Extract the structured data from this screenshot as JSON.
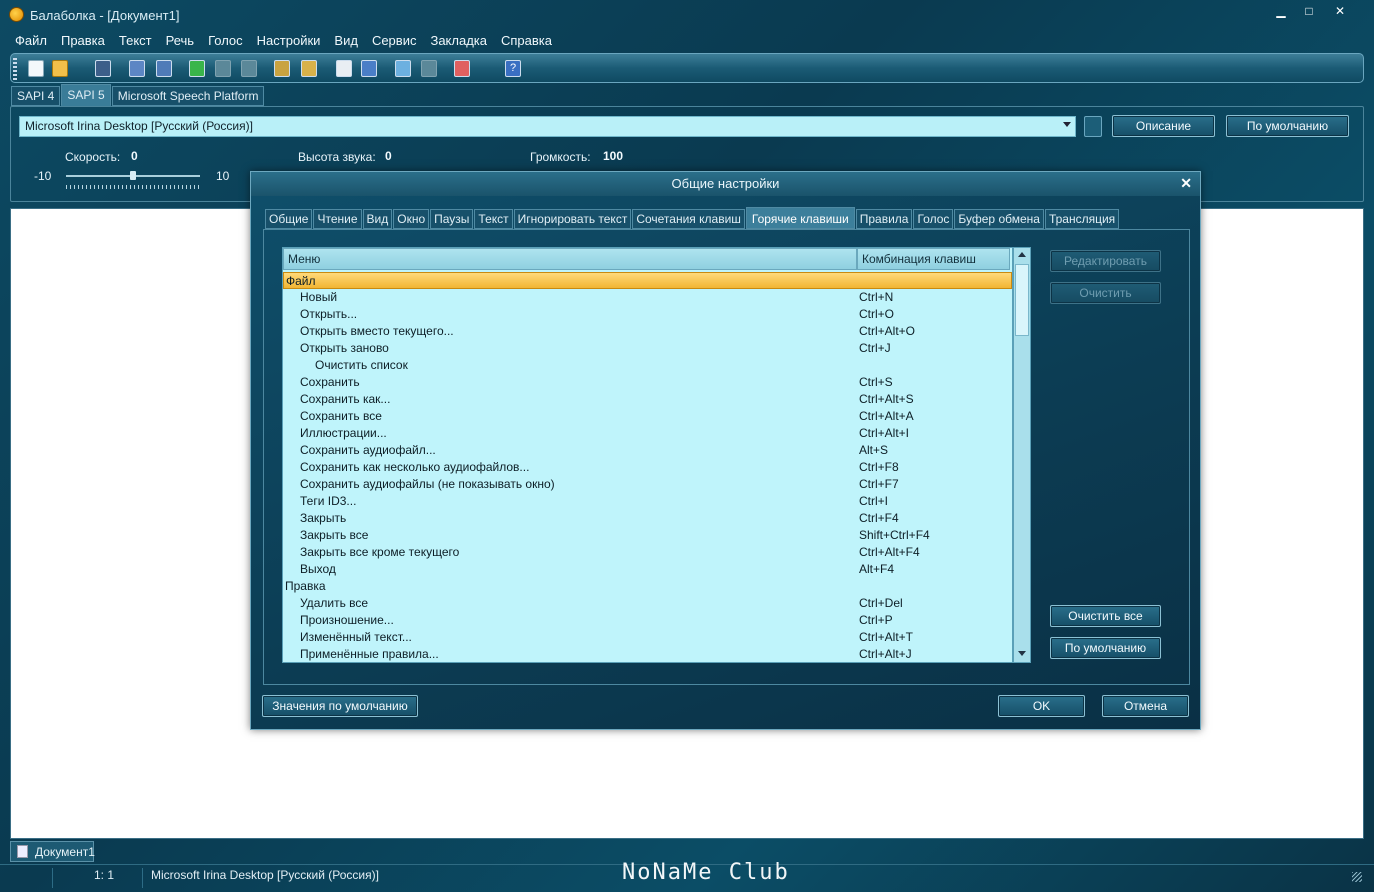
{
  "window": {
    "title": "Балаболка - [Документ1]",
    "controls": {
      "minimize": "▁",
      "maximize": "□",
      "close": "✕"
    }
  },
  "menu": [
    "Файл",
    "Правка",
    "Текст",
    "Речь",
    "Голос",
    "Настройки",
    "Вид",
    "Сервис",
    "Закладка",
    "Справка"
  ],
  "engine_tabs": [
    "SAPI 4",
    "SAPI 5",
    "Microsoft Speech Platform"
  ],
  "engine_tab_active": "SAPI 5",
  "voice": {
    "selected": "Microsoft Irina Desktop [Русский (Россия)]",
    "description_button": "Описание",
    "default_button": "По умолчанию"
  },
  "params": {
    "speed_label": "Скорость:",
    "speed_value": "0",
    "pitch_label": "Высота звука:",
    "pitch_value": "0",
    "volume_label": "Громкость:",
    "volume_value": "100",
    "slider_min": "-10",
    "slider_max": "10"
  },
  "dialog": {
    "title": "Общие настройки",
    "close": "✕",
    "tabs": [
      "Общие",
      "Чтение",
      "Вид",
      "Окно",
      "Паузы",
      "Текст",
      "Игнорировать текст",
      "Сочетания клавиш",
      "Горячие клавиши",
      "Правила",
      "Голос",
      "Буфер обмена",
      "Трансляция"
    ],
    "active_tab": "Горячие клавиши",
    "grid": {
      "columns": [
        "Меню",
        "Комбинация клавиш"
      ],
      "rows": [
        {
          "menu": "Файл",
          "keys": "",
          "level": 0,
          "selected": true
        },
        {
          "menu": "Новый",
          "keys": "Ctrl+N",
          "level": 1
        },
        {
          "menu": "Открыть...",
          "keys": "Ctrl+O",
          "level": 1
        },
        {
          "menu": "Открыть вместо текущего...",
          "keys": "Ctrl+Alt+O",
          "level": 1
        },
        {
          "menu": "Открыть заново",
          "keys": "Ctrl+J",
          "level": 1
        },
        {
          "menu": "Очистить список",
          "keys": "",
          "level": 2
        },
        {
          "menu": "Сохранить",
          "keys": "Ctrl+S",
          "level": 1
        },
        {
          "menu": "Сохранить как...",
          "keys": "Ctrl+Alt+S",
          "level": 1
        },
        {
          "menu": "Сохранить все",
          "keys": "Ctrl+Alt+A",
          "level": 1
        },
        {
          "menu": "Иллюстрации...",
          "keys": "Ctrl+Alt+I",
          "level": 1
        },
        {
          "menu": "Сохранить аудиофайл...",
          "keys": "Alt+S",
          "level": 1
        },
        {
          "menu": "Сохранить как несколько аудиофайлов...",
          "keys": "Ctrl+F8",
          "level": 1
        },
        {
          "menu": "Сохранить аудиофайлы (не показывать окно)",
          "keys": "Ctrl+F7",
          "level": 1
        },
        {
          "menu": "Теги ID3...",
          "keys": "Ctrl+I",
          "level": 1
        },
        {
          "menu": "Закрыть",
          "keys": "Ctrl+F4",
          "level": 1
        },
        {
          "menu": "Закрыть все",
          "keys": "Shift+Ctrl+F4",
          "level": 1
        },
        {
          "menu": "Закрыть все кроме текущего",
          "keys": "Ctrl+Alt+F4",
          "level": 1
        },
        {
          "menu": "Выход",
          "keys": "Alt+F4",
          "level": 1
        },
        {
          "menu": "Правка",
          "keys": "",
          "level": 0
        },
        {
          "menu": "Удалить все",
          "keys": "Ctrl+Del",
          "level": 1
        },
        {
          "menu": "Произношение...",
          "keys": "Ctrl+P",
          "level": 1
        },
        {
          "menu": "Изменённый текст...",
          "keys": "Ctrl+Alt+T",
          "level": 1
        },
        {
          "menu": "Применённые правила...",
          "keys": "Ctrl+Alt+J",
          "level": 1
        }
      ]
    },
    "buttons": {
      "edit": "Редактировать",
      "clear": "Очистить",
      "clear_all": "Очистить все",
      "defaults": "По умолчанию",
      "default_values": "Значения по умолчанию",
      "ok": "OK",
      "cancel": "Отмена"
    }
  },
  "doc_tab": "Документ1",
  "status": {
    "position": "1:   1",
    "voice": "Microsoft Irina Desktop [Русский (Россия)]",
    "watermark": "NoNaMe Club"
  },
  "colors": {
    "background": "#0c4159",
    "grid_bg": "#bff4fb",
    "selection": "#f2b533"
  }
}
